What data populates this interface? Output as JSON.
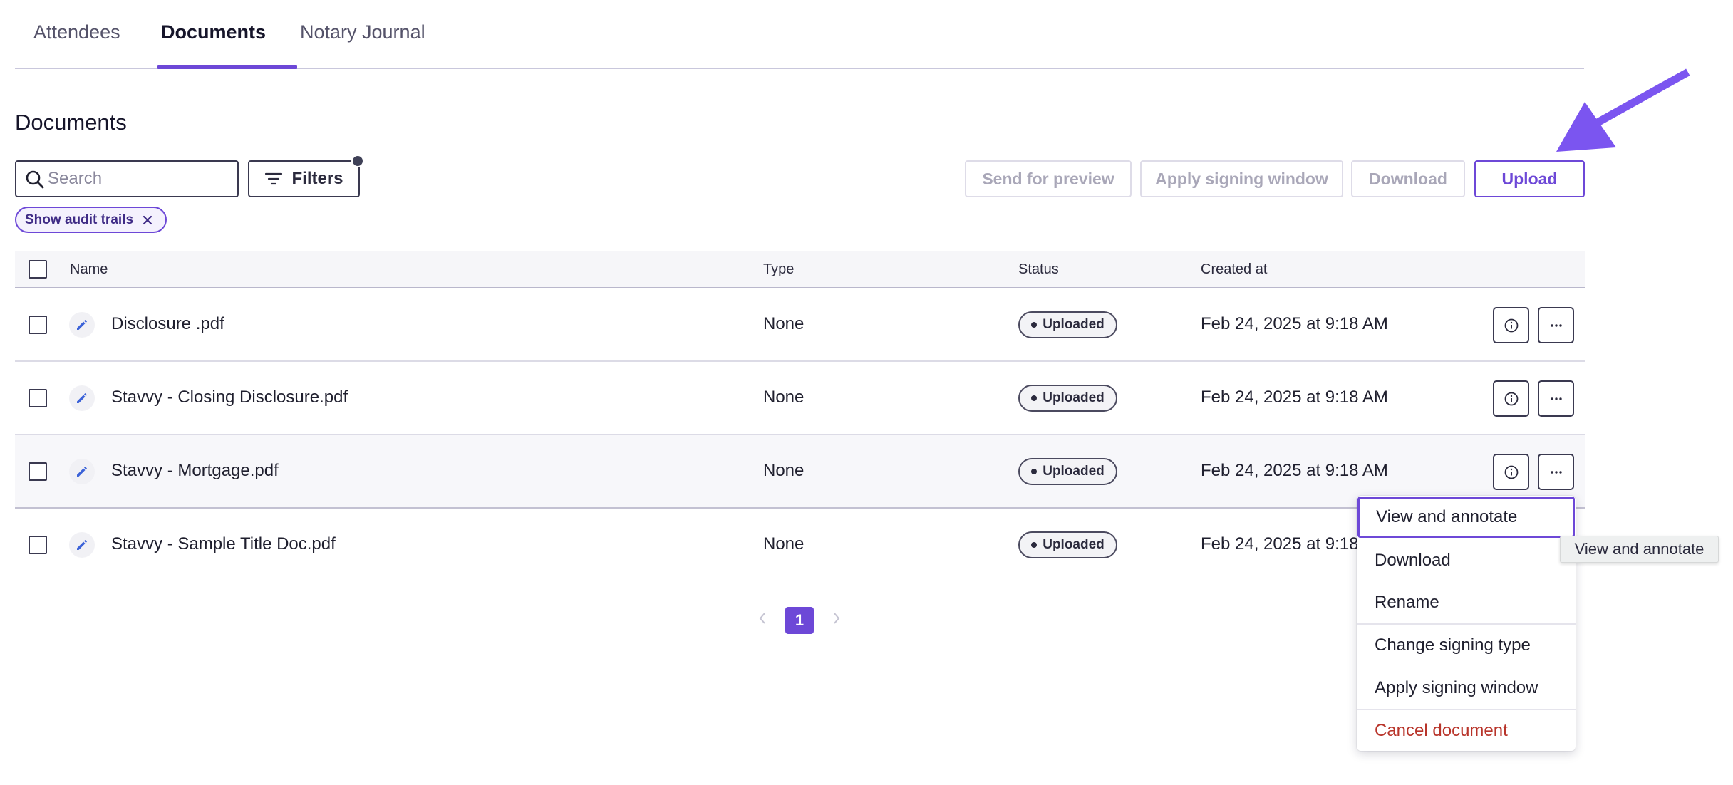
{
  "tabs": [
    {
      "label": "Attendees",
      "active": false
    },
    {
      "label": "Documents",
      "active": true
    },
    {
      "label": "Notary Journal",
      "active": false
    }
  ],
  "section_title": "Documents",
  "search": {
    "placeholder": "Search",
    "value": ""
  },
  "filters": {
    "label": "Filters",
    "has_active_indicator": true
  },
  "actions": {
    "send_for_preview": "Send for preview",
    "apply_signing_window": "Apply signing window",
    "download": "Download",
    "upload": "Upload"
  },
  "chip": {
    "label": "Show audit trails"
  },
  "table": {
    "columns": {
      "name": "Name",
      "type": "Type",
      "status": "Status",
      "created_at": "Created at"
    },
    "rows": [
      {
        "name": "Disclosure .pdf",
        "type": "None",
        "status": "Uploaded",
        "created_at": "Feb 24, 2025 at 9:18 AM"
      },
      {
        "name": "Stavvy - Closing Disclosure.pdf",
        "type": "None",
        "status": "Uploaded",
        "created_at": "Feb 24, 2025 at 9:18 AM"
      },
      {
        "name": "Stavvy - Mortgage.pdf",
        "type": "None",
        "status": "Uploaded",
        "created_at": "Feb 24, 2025 at 9:18 AM"
      },
      {
        "name": "Stavvy - Sample Title Doc.pdf",
        "type": "None",
        "status": "Uploaded",
        "created_at": "Feb 24, 2025 at 9:18"
      }
    ]
  },
  "pagination": {
    "current_page": "1"
  },
  "menu": {
    "items": [
      {
        "label": "View and annotate"
      },
      {
        "label": "Download"
      },
      {
        "label": "Rename"
      },
      {
        "label": "Change signing type"
      },
      {
        "label": "Apply signing window"
      },
      {
        "label": "Cancel document"
      }
    ]
  },
  "tooltip": {
    "text": "View and annotate"
  },
  "colors": {
    "accent": "#6d48d7",
    "danger": "#b8342a",
    "arrow": "#7b55f0"
  }
}
